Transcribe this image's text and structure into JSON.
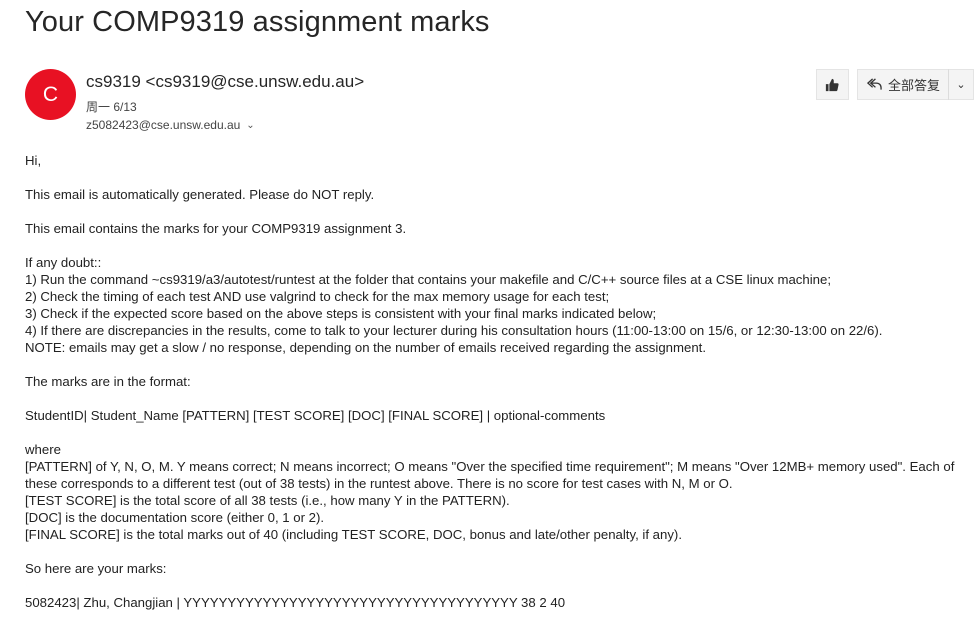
{
  "email": {
    "subject": "Your COMP9319 assignment marks",
    "avatar_letter": "C",
    "sender": "cs9319 <cs9319@cse.unsw.edu.au>",
    "date": "周一 6/13",
    "recipient": "z5082423@cse.unsw.edu.au",
    "actions": {
      "reply_all_label": "全部答复"
    }
  },
  "body": {
    "greeting": "Hi,",
    "auto": "This email is automatically generated. Please do NOT reply.",
    "contains": "This email contains the marks for your COMP9319 assignment 3.",
    "doubt_title": "If any doubt::",
    "doubt": [
      "1) Run the command ~cs9319/a3/autotest/runtest at the folder that contains your makefile and C/C++ source files at a CSE linux machine;",
      "2) Check the timing of each test AND use valgrind to check for the max memory usage for each test;",
      "3) Check if the expected score based on the above steps is consistent with your final marks indicated below;",
      "4) If there are discrepancies in the results, come to talk to your lecturer during his consultation hours (11:00-13:00 on 15/6, or 12:30-13:00 on 22/6).",
      "NOTE: emails may get a slow / no response, depending on the number of emails received regarding the assignment."
    ],
    "format_intro": "The marks are in the format:",
    "format": "StudentID| Student_Name [PATTERN] [TEST SCORE] [DOC] [FINAL SCORE] | optional-comments",
    "where": "where",
    "definitions": [
      "[PATTERN] of Y, N, O, M. Y means correct; N means incorrect; O means \"Over the specified time requirement\"; M means \"Over 12MB+ memory used\". Each of these corresponds to a different test (out of 38 tests) in the runtest above. There is no score for test cases with N, M or O.",
      "[TEST SCORE] is the total score of all 38 tests (i.e., how many Y in the PATTERN).",
      "[DOC] is the documentation score (either 0, 1 or 2).",
      "[FINAL SCORE] is the total marks out of 40 (including TEST SCORE, DOC, bonus and late/other penalty, if any)."
    ],
    "marks_intro": "So here are your marks:",
    "marks": "5082423| Zhu, Changjian  | YYYYYYYYYYYYYYYYYYYYYYYYYYYYYYYYYYYYYY 38 2 40"
  }
}
